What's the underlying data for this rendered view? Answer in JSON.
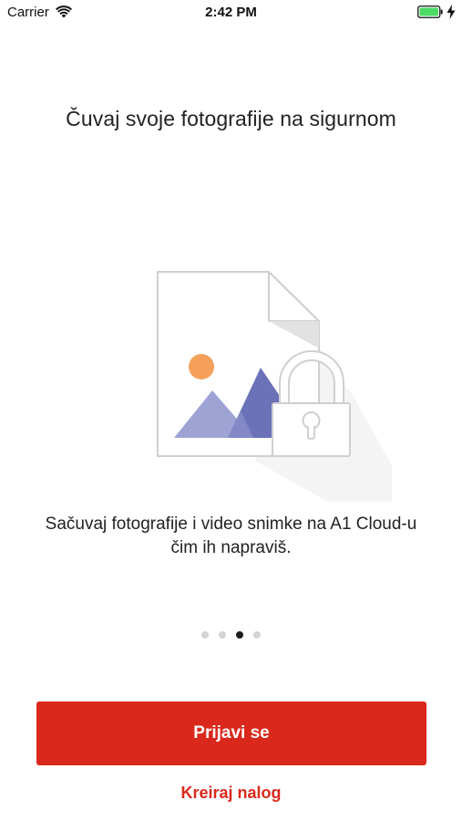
{
  "status_bar": {
    "carrier": "Carrier",
    "time": "2:42 PM",
    "icons": [
      "wifi-icon",
      "battery-icon",
      "charging-icon"
    ],
    "battery_color": "#4cd964"
  },
  "onboarding": {
    "title": "Čuvaj svoje fotografije na sigurnom",
    "illustration_icon": "locked-photo-file-icon",
    "description": "Sačuvaj fotografije i video snimke na A1 Cloud-u čim ih napraviš.",
    "pager": {
      "pages": 4,
      "active_page": 3
    }
  },
  "actions": {
    "login_label": "Prijavi se",
    "create_account_label": "Kreiraj nalog"
  },
  "colors": {
    "accent": "#da291c",
    "text": "#222222",
    "dot_inactive": "#d4d4d4",
    "dot_active": "#1e1e1e",
    "mountain_light": "#9ea3d4",
    "mountain_dark": "#6b72b8",
    "sun": "#f5a05a"
  }
}
